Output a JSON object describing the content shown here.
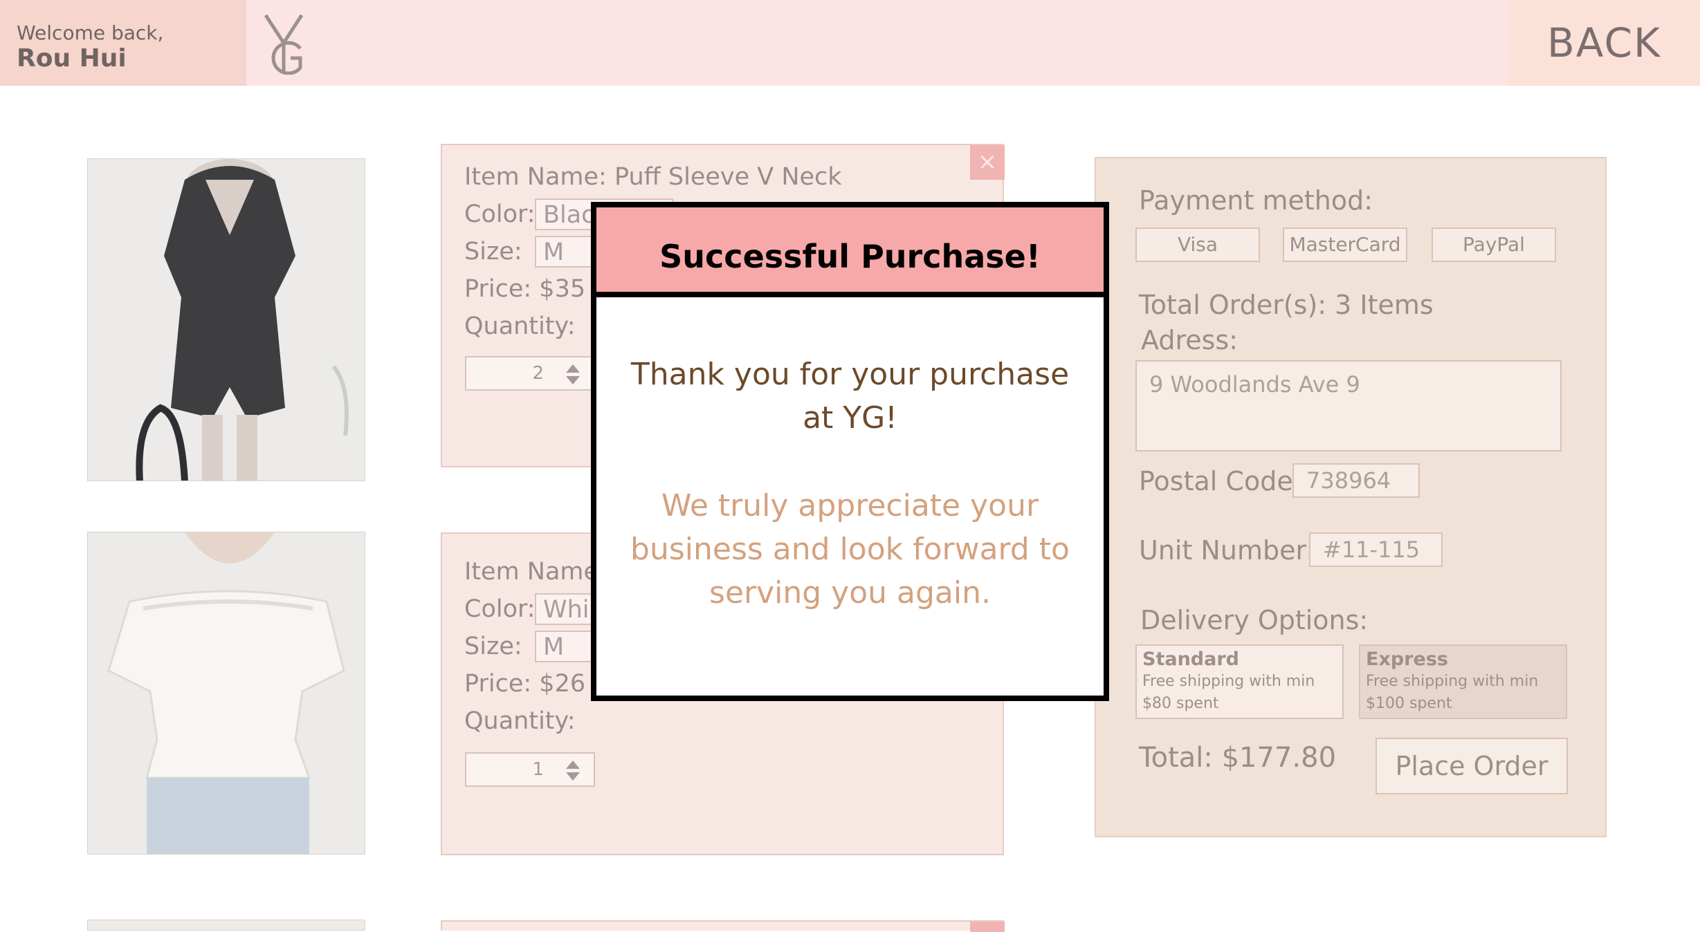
{
  "header": {
    "welcome_text": "Welcome back,",
    "user_name": "Rou Hui",
    "logo_text": "YG",
    "back_label": "BACK"
  },
  "items": [
    {
      "name_line": "Item Name: Puff Sleeve V Neck",
      "color_label": "Color:",
      "color_value": "Blac",
      "size_label": "Size:",
      "size_value": "M",
      "price_line": "Price: $35",
      "quantity_label": "Quantity:",
      "quantity": "2",
      "close": "×"
    },
    {
      "name_line": "Item Name",
      "color_label": "Color:",
      "color_value": "Whi",
      "size_label": "Size:",
      "size_value": "M",
      "price_line": "Price: $26",
      "quantity_label": "Quantity:",
      "quantity": "1"
    }
  ],
  "checkout": {
    "payment_label": "Payment method:",
    "payment_options": [
      "Visa",
      "MasterCard",
      "PayPal"
    ],
    "total_orders": "Total Order(s): 3 Items",
    "address_label": "Adress:",
    "address_value": "9 Woodlands Ave 9",
    "postal_label": "Postal Code:",
    "postal_value": "738964",
    "unit_label": "Unit Number:",
    "unit_value": "#11-115",
    "delivery_label": "Delivery Options:",
    "delivery_options": [
      {
        "title": "Standard",
        "desc": "Free shipping with min $80 spent"
      },
      {
        "title": "Express",
        "desc": "Free shipping with min $100 spent"
      }
    ],
    "total": "Total: $177.80",
    "place_order_label": "Place Order"
  },
  "modal": {
    "title": "Successful Purchase!",
    "thanks": "Thank you for your purchase at YG!",
    "appreciate": "We truly appreciate your business and look forward to serving you again."
  },
  "colors": {
    "header_bg": "#fde4e4",
    "modal_header": "#f7a9a9",
    "thanks_text": "#6b4a2a",
    "appreciate_text": "#d4a17e"
  }
}
